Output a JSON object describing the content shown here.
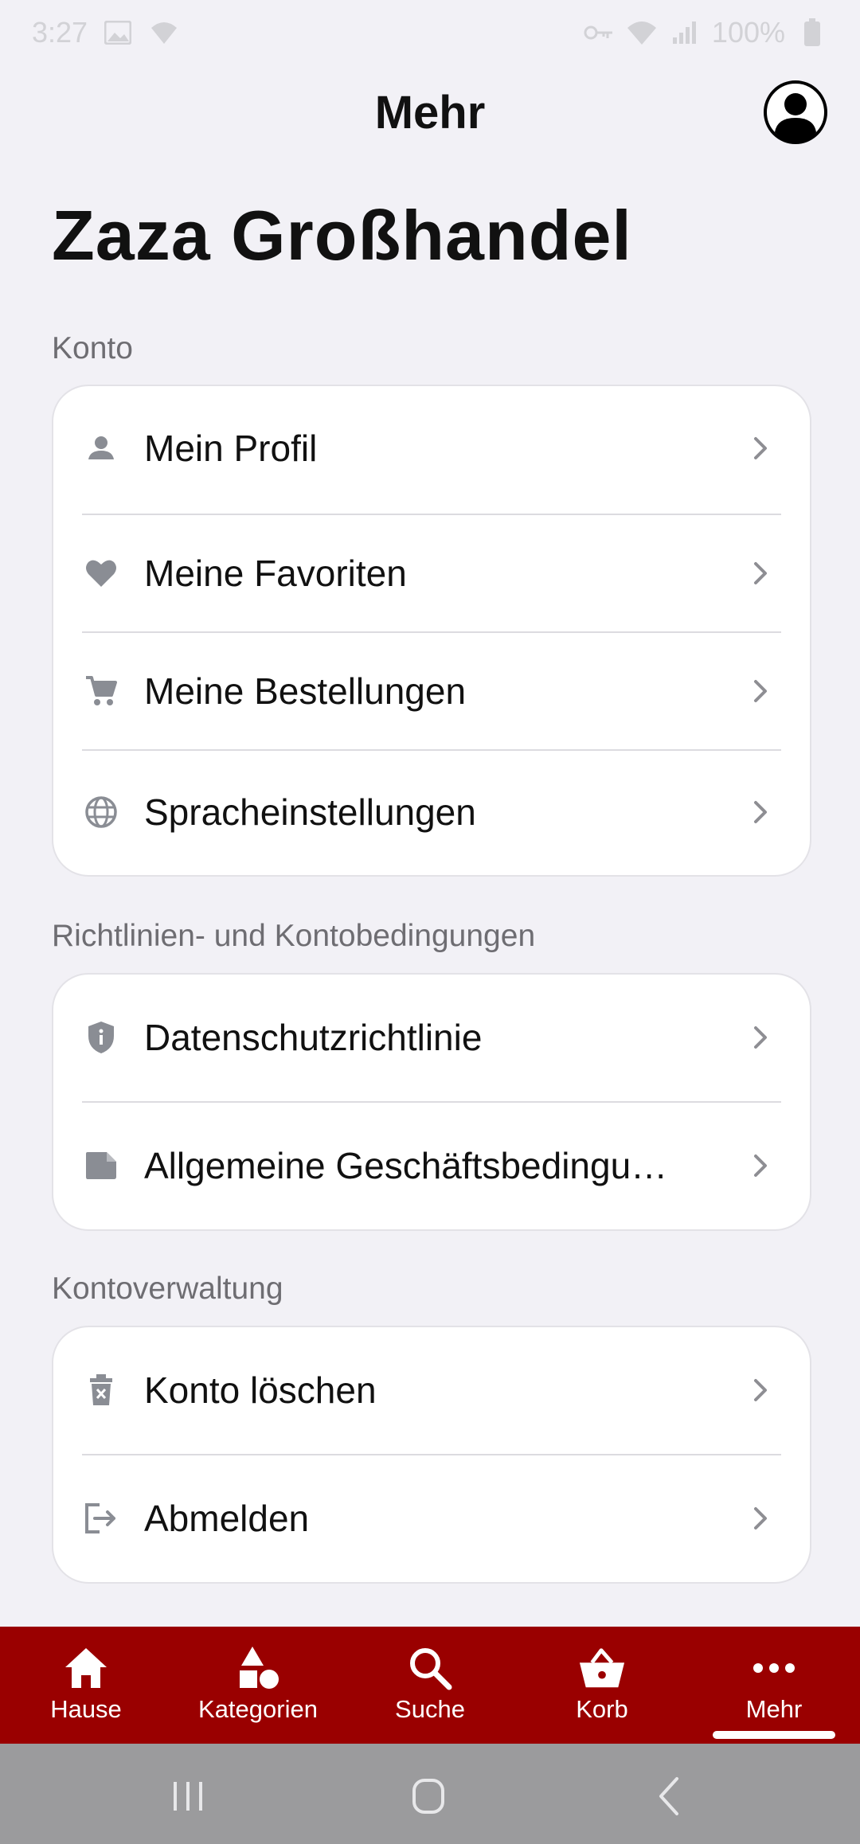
{
  "status": {
    "time": "3:27",
    "battery": "100%"
  },
  "header": {
    "title": "Mehr"
  },
  "page_title": "Zaza Großhandel",
  "sections": [
    {
      "label": "Konto",
      "items": [
        {
          "label": "Mein Profil",
          "icon": "person-icon"
        },
        {
          "label": "Meine Favoriten",
          "icon": "heart-icon"
        },
        {
          "label": "Meine Bestellungen",
          "icon": "cart-icon"
        },
        {
          "label": "Spracheinstellungen",
          "icon": "globe-icon"
        }
      ]
    },
    {
      "label": "Richtlinien- und Kontobedingungen",
      "items": [
        {
          "label": "Datenschutzrichtlinie",
          "icon": "shield-icon"
        },
        {
          "label": "Allgemeine Geschäftsbedingu…",
          "icon": "document-icon"
        }
      ]
    },
    {
      "label": "Kontoverwaltung",
      "items": [
        {
          "label": "Konto löschen",
          "icon": "trash-icon"
        },
        {
          "label": "Abmelden",
          "icon": "logout-icon"
        }
      ]
    }
  ],
  "bottom_nav": {
    "items": [
      {
        "label": "Hause",
        "icon": "home-icon"
      },
      {
        "label": "Kategorien",
        "icon": "shapes-icon"
      },
      {
        "label": "Suche",
        "icon": "search-icon"
      },
      {
        "label": "Korb",
        "icon": "basket-icon"
      },
      {
        "label": "Mehr",
        "icon": "more-icon",
        "active": true
      }
    ]
  },
  "colors": {
    "background": "#f2f1f6",
    "nav_bar": "#9a0000",
    "icon_gray": "#8a8d94",
    "chevron": "#8e8e93"
  }
}
